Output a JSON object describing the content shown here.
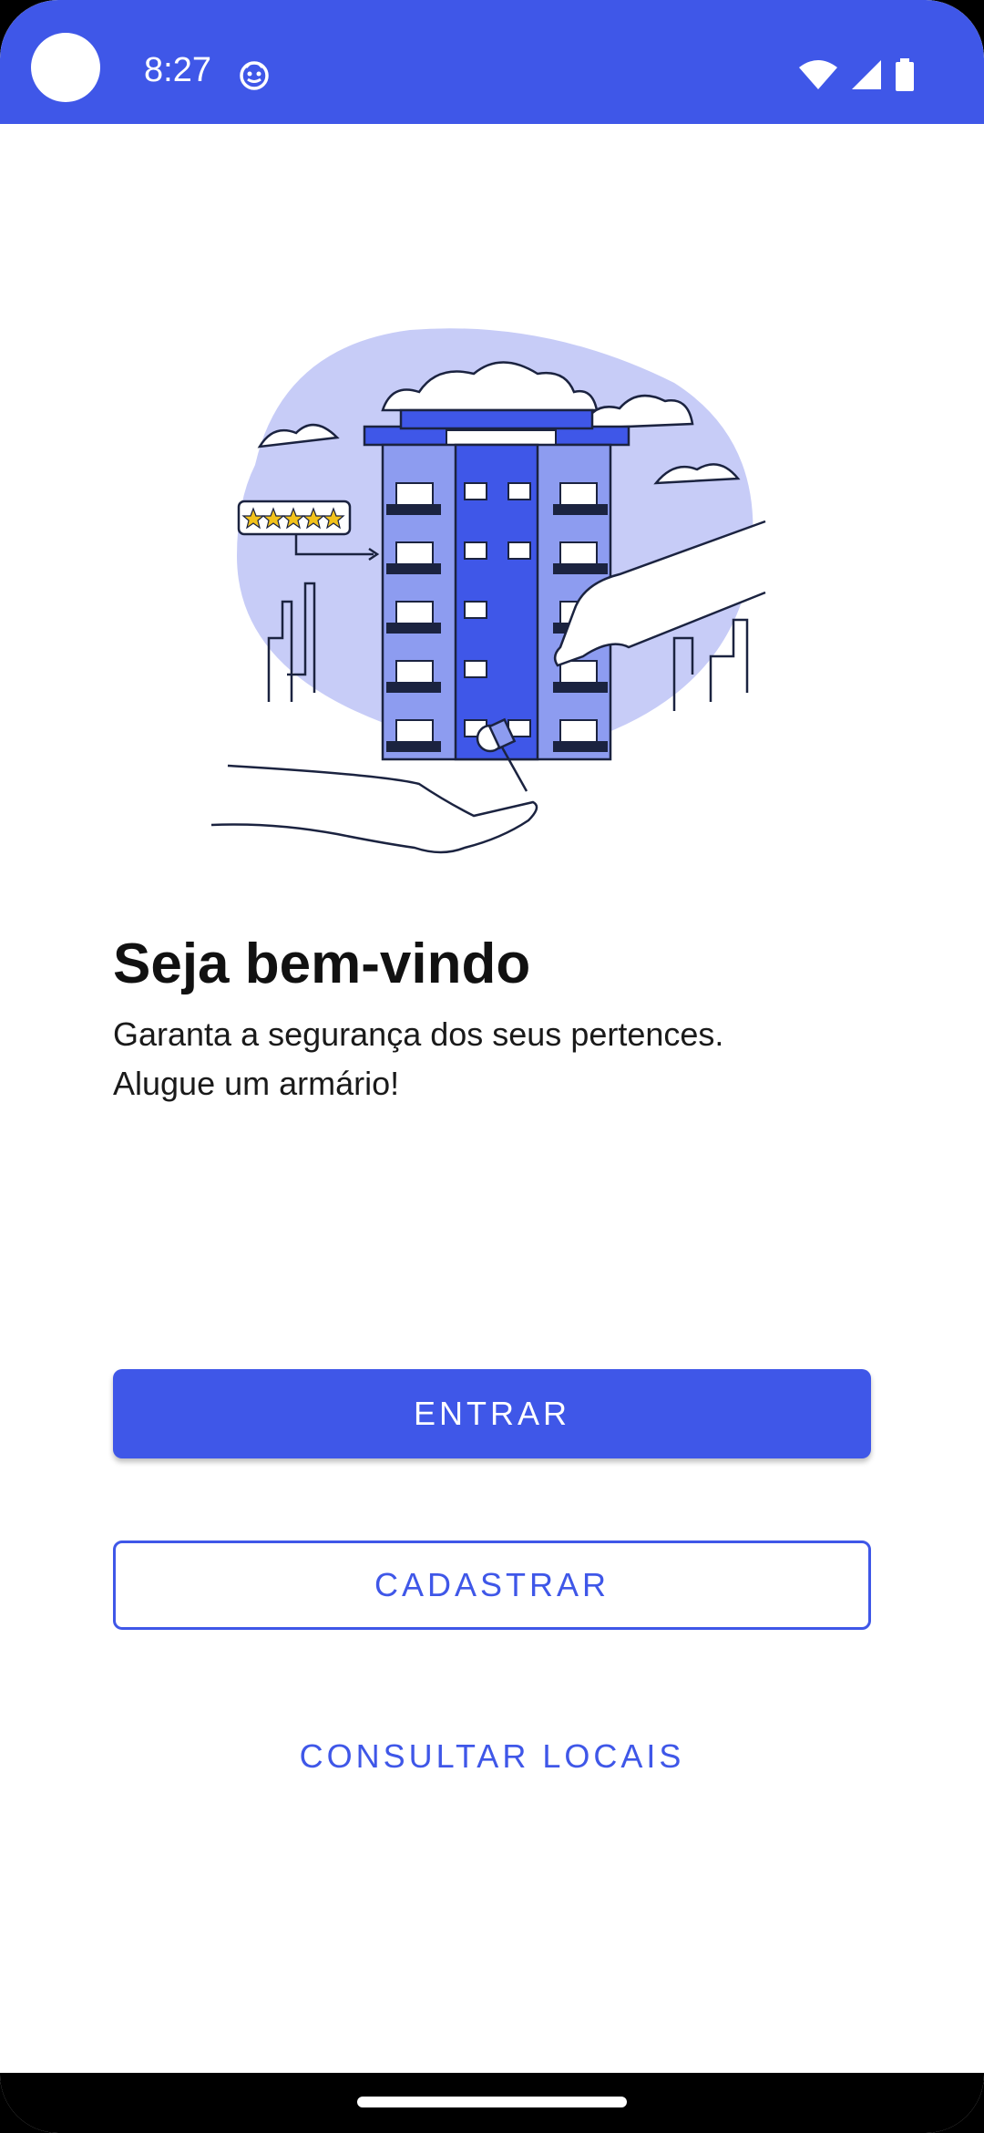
{
  "colors": {
    "accent": "#3f57e8",
    "status_bar": "#3f57e8",
    "illustration_blob": "#c7ccf7",
    "building": "#3f57e8",
    "outline": "#1b2340"
  },
  "status_bar": {
    "time": "8:27",
    "icons": [
      "camera-hole",
      "notification-icon",
      "wifi-icon",
      "signal-icon",
      "battery-icon"
    ]
  },
  "illustration": {
    "icon": "building-handover-illustration",
    "rating_stars": 5
  },
  "welcome": {
    "title": "Seja bem-vindo",
    "subtitle_line1": "Garanta a segurança dos seus pertences.",
    "subtitle_line2": "Alugue um armário!"
  },
  "actions": {
    "login_label": "ENTRAR",
    "register_label": "CADASTRAR",
    "locations_label": "CONSULTAR LOCAIS"
  }
}
